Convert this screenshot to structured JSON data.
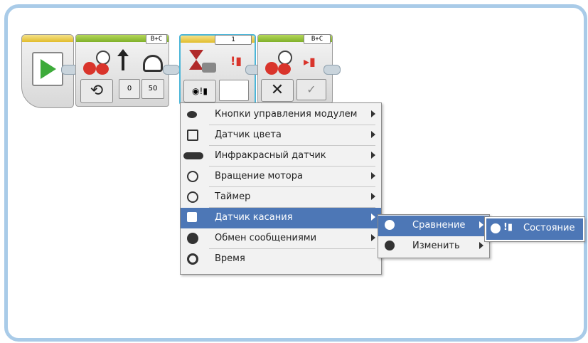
{
  "blocks": {
    "move_tank": {
      "ports": "B+C",
      "power": "0",
      "speed": "50"
    },
    "wait": {
      "port": "1"
    },
    "move_tank_off": {
      "ports": "B+C"
    }
  },
  "menu": {
    "items": [
      {
        "label": "Кнопки управления модулем",
        "icon": "brick-buttons-icon"
      },
      {
        "label": "Датчик цвета",
        "icon": "color-sensor-icon"
      },
      {
        "label": "Инфракрасный датчик",
        "icon": "infrared-sensor-icon"
      },
      {
        "label": "Вращение мотора",
        "icon": "motor-rotation-icon"
      },
      {
        "label": "Таймер",
        "icon": "timer-icon"
      },
      {
        "label": "Датчик касания",
        "icon": "touch-sensor-icon"
      },
      {
        "label": "Обмен сообщениями",
        "icon": "bluetooth-icon"
      },
      {
        "label": "Время",
        "icon": "time-icon"
      }
    ],
    "highlighted": "Датчик касания"
  },
  "submenu": {
    "items": [
      {
        "label": "Сравнение",
        "icon": "compare-icon"
      },
      {
        "label": "Изменить",
        "icon": "change-icon"
      }
    ]
  },
  "submenu2": {
    "items": [
      {
        "label": "Состояние",
        "icon": "state-icon"
      }
    ]
  },
  "colors": {
    "frame": "#a9cbe8",
    "highlight": "#4d77b6",
    "start_arrow": "#3dab3a",
    "motor_header": "#7fb02a",
    "wait_header": "#e2bc2c"
  }
}
